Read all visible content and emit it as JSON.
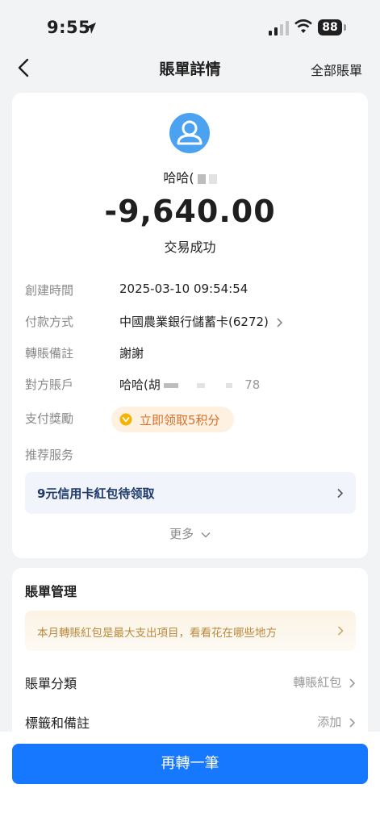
{
  "status_bar": {
    "time": "9:55",
    "battery": "88"
  },
  "nav": {
    "title": "賬單詳情",
    "right_link": "全部賬單"
  },
  "summary": {
    "name": "哈哈(",
    "amount": "-9,640.00",
    "status": "交易成功"
  },
  "details": {
    "created_label": "創建時間",
    "created_value": "2025-03-10 09:54:54",
    "payment_label": "付款方式",
    "payment_value": "中國農業銀行儲蓄卡(6272)",
    "note_label": "轉賬備註",
    "note_value": "謝謝",
    "account_label": "對方賬戶",
    "account_value": "哈哈(胡",
    "account_tail": "78",
    "reward_label": "支付獎勵",
    "reward_value": "立即领取5积分",
    "service_label": "推荐服务"
  },
  "promo": {
    "text": "9元信用卡紅包待领取"
  },
  "more": "更多",
  "management": {
    "title": "賬單管理",
    "tip": "本月轉賬紅包是最大支出項目，看看花在哪些地方",
    "category_label": "賬單分類",
    "category_value": "轉賬紅包",
    "tags_label": "標籤和備註",
    "tags_value": "添加"
  },
  "action": {
    "label": "再轉一筆"
  },
  "colors": {
    "primary": "#1677ff",
    "avatar": "#4aa2f0",
    "reward": "#d4712a",
    "promo": "#1d3a6b"
  }
}
